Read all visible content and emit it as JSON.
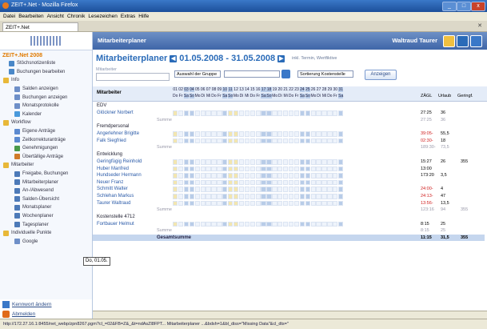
{
  "window": {
    "title": "ZEIT+.Net - Mozilla Firefox"
  },
  "menu": [
    "Datei",
    "Bearbeiten",
    "Ansicht",
    "Chronik",
    "Lesezeichen",
    "Extras",
    "Hilfe"
  ],
  "tab": {
    "label": "ZEIT+.Net"
  },
  "sidebar": {
    "title": "ZEIT+.Net 2008",
    "items": [
      {
        "label": "Stöchsnotizenliste",
        "indent": 1,
        "icon": "person-icon"
      },
      {
        "label": "Buchungen bearbeiten",
        "indent": 1,
        "icon": "edit-icon"
      },
      {
        "label": "Info",
        "indent": 0,
        "icon": "folder-icon"
      },
      {
        "label": "Salden anzeigen",
        "indent": 2,
        "icon": "document-icon"
      },
      {
        "label": "Buchungen anzeigen",
        "indent": 2,
        "icon": "document-icon"
      },
      {
        "label": "Monatsprotokolle",
        "indent": 2,
        "icon": "document-icon"
      },
      {
        "label": "Kalender",
        "indent": 2,
        "icon": "calendar-icon"
      },
      {
        "label": "Workflow",
        "indent": 0,
        "icon": "folder-icon"
      },
      {
        "label": "Eigene Anträge",
        "indent": 2,
        "icon": "pencil-icon"
      },
      {
        "label": "Zeitkorrekturanträge",
        "indent": 2,
        "icon": "pencil-icon"
      },
      {
        "label": "Genehmigungen",
        "indent": 2,
        "icon": "check-icon"
      },
      {
        "label": "Übertällige Anträge",
        "indent": 2,
        "icon": "clock-icon"
      },
      {
        "label": "Mitarbeiter",
        "indent": 0,
        "icon": "folder-icon"
      },
      {
        "label": "Freigabe, Buchungen",
        "indent": 2,
        "icon": "people-icon"
      },
      {
        "label": "Mitarbeiterplaner",
        "indent": 2,
        "icon": "people-icon"
      },
      {
        "label": "An-/Abwesend",
        "indent": 2,
        "icon": "people-icon"
      },
      {
        "label": "Salden-Übersicht",
        "indent": 2,
        "icon": "people-icon"
      },
      {
        "label": "Monatsplaner",
        "indent": 2,
        "icon": "people-icon"
      },
      {
        "label": "Wochenplaner",
        "indent": 2,
        "icon": "people-icon"
      },
      {
        "label": "Tagesplaner",
        "indent": 2,
        "icon": "people-icon"
      },
      {
        "label": "Individuelle Punkte",
        "indent": 0,
        "icon": "folder-icon"
      },
      {
        "label": "Google",
        "indent": 2,
        "icon": "document-icon"
      }
    ],
    "bottom": [
      {
        "label": "Kennwort ändern"
      },
      {
        "label": "Abmelden"
      }
    ]
  },
  "header": {
    "left": "Mitarbeiterplaner",
    "right": "Waltraud Taurer"
  },
  "planner": {
    "title": "Mitarbeiterplaner",
    "range": "01.05.2008 - 31.05.2008",
    "subtitle": "inkl. Termin, Wertfiktive",
    "filter_label": "Mitarbeiter",
    "group_select": "Auswahl der Gruppe",
    "sort_select": "Sortierung Kostenstelle",
    "show_button": "Anzeigen",
    "col_employee": "Mitarbeiter",
    "col_zaehl": "ZÄGL",
    "col_urlaub": "Urlaub",
    "col_gering": "Geringf.",
    "days": [
      "01",
      "02",
      "03",
      "04",
      "05",
      "06",
      "07",
      "08",
      "09",
      "10",
      "11",
      "12",
      "13",
      "14",
      "15",
      "16",
      "17",
      "18",
      "19",
      "20",
      "21",
      "22",
      "23",
      "24",
      "25",
      "26",
      "27",
      "28",
      "29",
      "30",
      "31"
    ],
    "daynames": [
      "Do",
      "Fr",
      "Sa",
      "So",
      "Mo",
      "Di",
      "Mi",
      "Do",
      "Fr",
      "Sa",
      "So",
      "Mo",
      "Di",
      "Mi",
      "Do",
      "Fr",
      "Sa",
      "So",
      "Mo",
      "Di",
      "Mi",
      "Do",
      "Fr",
      "Sa",
      "So",
      "Mo",
      "Di",
      "Mi",
      "Do",
      "Fr",
      "Sa"
    ],
    "tooltip": "Do, 01.05."
  },
  "rows": [
    {
      "type": "group",
      "name": "EDV"
    },
    {
      "type": "emp",
      "name": "Glöckner Norbert",
      "zaehl": "27:25",
      "urlaub": "36",
      "gering": ""
    },
    {
      "type": "sum",
      "name": "Summe",
      "zaehl": "27:25",
      "urlaub": "36",
      "gering": ""
    },
    {
      "type": "group",
      "name": "Fremdpersonal"
    },
    {
      "type": "emp",
      "name": "Angerlehner Brigitte",
      "zaehl": "39:05-",
      "urlaub": "55,5",
      "gering": "",
      "red": true
    },
    {
      "type": "emp",
      "name": "Falk Siegfried",
      "zaehl": "02:30-",
      "urlaub": "18",
      "gering": "",
      "red": true
    },
    {
      "type": "sum",
      "name": "Summe",
      "zaehl": "189:30-",
      "urlaub": "73,5",
      "gering": ""
    },
    {
      "type": "group",
      "name": "Entwicklung"
    },
    {
      "type": "emp",
      "name": "Geringfügig Reinhold",
      "zaehl": "15:27",
      "urlaub": "26",
      "gering": "355"
    },
    {
      "type": "emp",
      "name": "Huber Manfred",
      "zaehl": "13:00",
      "urlaub": "",
      "gering": ""
    },
    {
      "type": "emp",
      "name": "Hundseder Hermann",
      "zaehl": "173:20",
      "urlaub": "3,5",
      "gering": ""
    },
    {
      "type": "emp",
      "name": "Neuer Franz",
      "zaehl": "",
      "urlaub": "",
      "gering": ""
    },
    {
      "type": "emp",
      "name": "Schmitt Walter",
      "zaehl": "24:00-",
      "urlaub": "4",
      "gering": "",
      "red": true
    },
    {
      "type": "emp",
      "name": "Schlehan Markus",
      "zaehl": "24:13-",
      "urlaub": "47",
      "gering": "",
      "red": true
    },
    {
      "type": "emp",
      "name": "Taurer Waltraud",
      "zaehl": "13:56-",
      "urlaub": "13,5",
      "gering": "",
      "red": true
    },
    {
      "type": "sum",
      "name": "Summe",
      "zaehl": "123:16",
      "urlaub": "94",
      "gering": "355"
    },
    {
      "type": "group",
      "name": "Kostenstelle 4712"
    },
    {
      "type": "emp",
      "name": "Fortbauer Helmut",
      "zaehl": "8:15",
      "urlaub": "25",
      "gering": ""
    },
    {
      "type": "sum",
      "name": "Summe",
      "zaehl": "8:15",
      "urlaub": "25",
      "gering": ""
    },
    {
      "type": "total",
      "name": "Gesamtsumme",
      "zaehl": "11:15",
      "urlaub": "31,5",
      "gering": "355"
    }
  ],
  "status": {
    "url": "http://172.27.16.1:8455/net_webp/zpn8267.pgm?cl_=02&FB=Z&_&t=ndAsZl8FPT... Mitarbeiterplaner ...&bdsh=1&bl_diss=\"Missing Data\"&cl_dts=\""
  }
}
